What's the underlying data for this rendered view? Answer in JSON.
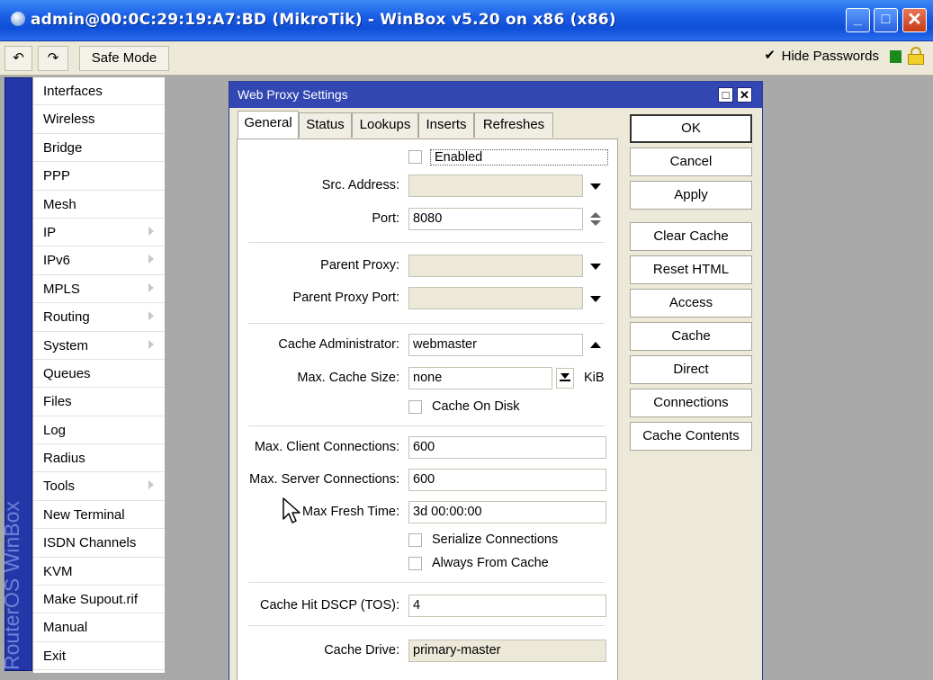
{
  "window": {
    "title": "admin@00:0C:29:19:A7:BD (MikroTik) - WinBox v5.20 on x86 (x86)",
    "minimize_label": "_",
    "maximize_label": "□",
    "close_label": "✕"
  },
  "toolbar": {
    "undo_icon": "↶",
    "redo_icon": "↷",
    "safe_mode_label": "Safe Mode",
    "hide_passwords_label": "Hide Passwords",
    "hide_passwords_checked": true,
    "hide_passwords_mark": "✔",
    "status_color": "#1a8a1a"
  },
  "brand": "RouterOS WinBox",
  "menu": {
    "items": [
      {
        "label": "Interfaces",
        "submenu": false
      },
      {
        "label": "Wireless",
        "submenu": false
      },
      {
        "label": "Bridge",
        "submenu": false
      },
      {
        "label": "PPP",
        "submenu": false
      },
      {
        "label": "Mesh",
        "submenu": false
      },
      {
        "label": "IP",
        "submenu": true
      },
      {
        "label": "IPv6",
        "submenu": true
      },
      {
        "label": "MPLS",
        "submenu": true
      },
      {
        "label": "Routing",
        "submenu": true
      },
      {
        "label": "System",
        "submenu": true
      },
      {
        "label": "Queues",
        "submenu": false
      },
      {
        "label": "Files",
        "submenu": false
      },
      {
        "label": "Log",
        "submenu": false
      },
      {
        "label": "Radius",
        "submenu": false
      },
      {
        "label": "Tools",
        "submenu": true
      },
      {
        "label": "New Terminal",
        "submenu": false
      },
      {
        "label": "ISDN Channels",
        "submenu": false
      },
      {
        "label": "KVM",
        "submenu": false
      },
      {
        "label": "Make Supout.rif",
        "submenu": false
      },
      {
        "label": "Manual",
        "submenu": false
      },
      {
        "label": "Exit",
        "submenu": false
      }
    ]
  },
  "dialog": {
    "title": "Web Proxy Settings",
    "restore_label": "□",
    "close_label": "✕",
    "tabs": [
      "General",
      "Status",
      "Lookups",
      "Inserts",
      "Refreshes"
    ],
    "active_tab": "General",
    "enabled_label": "Enabled",
    "enabled_checked": false,
    "src_address_label": "Src. Address:",
    "src_address_value": "",
    "port_label": "Port:",
    "port_value": "8080",
    "parent_proxy_label": "Parent Proxy:",
    "parent_proxy_value": "",
    "parent_proxy_port_label": "Parent Proxy Port:",
    "parent_proxy_port_value": "",
    "cache_admin_label": "Cache Administrator:",
    "cache_admin_value": "webmaster",
    "max_cache_size_label": "Max. Cache Size:",
    "max_cache_size_value": "none",
    "max_cache_size_unit": "KiB",
    "cache_on_disk_label": "Cache On Disk",
    "cache_on_disk_checked": false,
    "max_client_conn_label": "Max. Client Connections:",
    "max_client_conn_value": "600",
    "max_server_conn_label": "Max. Server Connections:",
    "max_server_conn_value": "600",
    "max_fresh_time_label": "Max Fresh Time:",
    "max_fresh_time_value": "3d 00:00:00",
    "serialize_conn_label": "Serialize Connections",
    "serialize_conn_checked": false,
    "always_from_cache_label": "Always From Cache",
    "always_from_cache_checked": false,
    "cache_hit_dscp_label": "Cache Hit DSCP (TOS):",
    "cache_hit_dscp_value": "4",
    "cache_drive_label": "Cache Drive:",
    "cache_drive_value": "primary-master",
    "buttons": {
      "ok": "OK",
      "cancel": "Cancel",
      "apply": "Apply",
      "clear_cache": "Clear Cache",
      "reset_html": "Reset HTML",
      "access": "Access",
      "cache": "Cache",
      "direct": "Direct",
      "connections": "Connections",
      "cache_contents": "Cache Contents"
    }
  }
}
